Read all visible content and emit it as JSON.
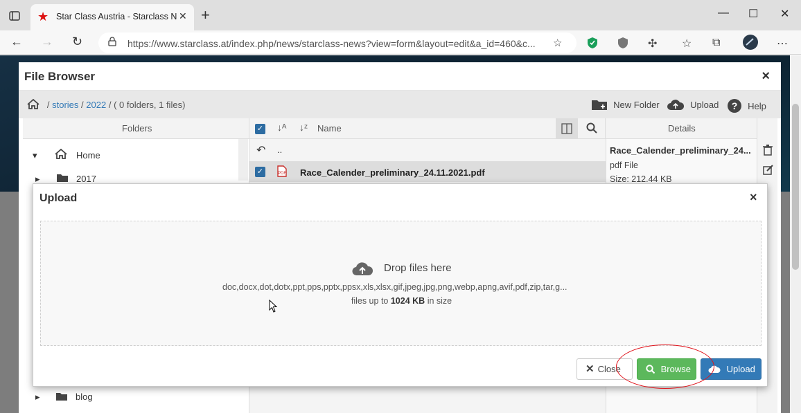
{
  "browser": {
    "tab_title": "Star Class Austria - Starclass New",
    "tab_close": "✕",
    "new_tab": "+",
    "url": "https://www.starclass.at/index.php/news/starclass-news?view=form&layout=edit&a_id=460&c...",
    "window_controls": [
      "—",
      "☐",
      "✕"
    ]
  },
  "file_browser": {
    "title": "File Browser",
    "close": "×",
    "breadcrumb": {
      "sep1": "/",
      "stories": "stories",
      "sep2": "/",
      "year": "2022",
      "sep3": "/",
      "summary": "( 0 folders, 1 files)"
    },
    "toolbar": {
      "new_folder": "New Folder",
      "upload": "Upload",
      "help": "Help"
    },
    "columns": {
      "folders": "Folders",
      "name": "Name",
      "details": "Details"
    },
    "tree": {
      "home": "Home",
      "folder_2017": "2017",
      "blog": "blog"
    },
    "files": {
      "parent": "..",
      "file_name": "Race_Calender_preliminary_24.11.2021.pdf"
    },
    "details": {
      "name": "Race_Calender_preliminary_24...",
      "type": "pdf File",
      "size": "Size: 212.44 KB"
    }
  },
  "upload_dialog": {
    "title": "Upload",
    "close": "×",
    "drop_text": "Drop files here",
    "allowed_types": "doc,docx,dot,dotx,ppt,pps,pptx,ppsx,xls,xlsx,gif,jpeg,jpg,png,webp,apng,avif,pdf,zip,tar,g...",
    "limit_prefix": "files up to",
    "limit_value": "1024 KB",
    "limit_suffix": "in size",
    "buttons": {
      "close": "Close",
      "browse": "Browse",
      "upload": "Upload"
    }
  },
  "colors": {
    "browse_green": "#5cb85c",
    "upload_blue": "#337ab7",
    "annotation_red": "#e0141c"
  }
}
